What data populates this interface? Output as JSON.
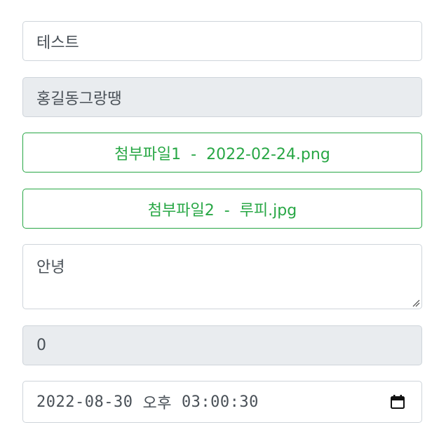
{
  "form": {
    "title_value": "테스트",
    "author_value": "홍길동그랑땡",
    "attachments": [
      {
        "label": "첨부파일1  -  2022-02-24.png"
      },
      {
        "label": "첨부파일2  -  루피.jpg"
      }
    ],
    "content_value": "안녕",
    "view_count": "0",
    "datetime": {
      "date": "2022-08-30",
      "ampm": "오후",
      "time": "03:00:30"
    }
  },
  "colors": {
    "attachment_accent": "#28a745",
    "readonly_bg": "#e9ecef",
    "border": "#ced4da",
    "text": "#495057"
  },
  "icons": {
    "datetime_picker": "calendar-icon"
  }
}
